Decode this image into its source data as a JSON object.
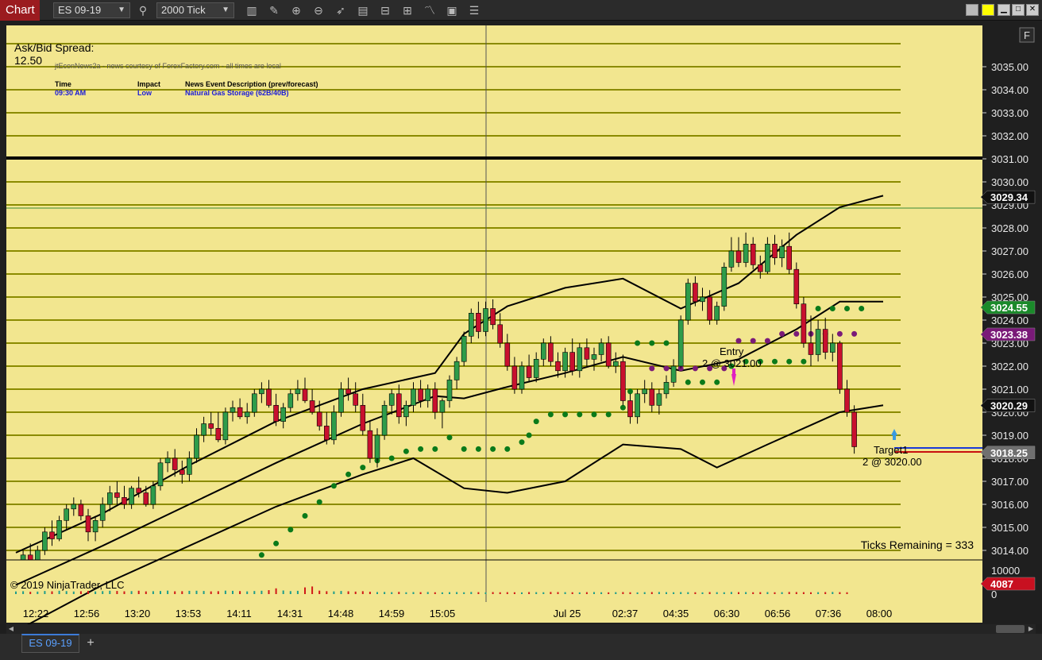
{
  "toolbar": {
    "chart_label": "Chart",
    "instrument": "ES 09-19",
    "interval": "2000 Tick",
    "icons": [
      "magnifier-icon",
      "bar-type-icon",
      "draw-icon",
      "zoom-in-icon",
      "zoom-out-icon",
      "pointer-icon",
      "data-box-icon",
      "templates-icon",
      "strategies-icon",
      "indicators-icon",
      "properties-icon",
      "chart-trader-icon"
    ],
    "window_buttons": [
      "color-gray-icon",
      "color-yellow-icon",
      "minimize-icon",
      "maximize-icon",
      "close-icon"
    ]
  },
  "colors": {
    "plot_bg": "#f2e68f",
    "chart_label_bg": "#9b1b1f",
    "grid_line": "#8b8b00",
    "up_candle": "#2e9c4a",
    "down_candle": "#c8102e",
    "bollinger": "#000000",
    "dots_green": "#0a7a1a",
    "dots_purple": "#7a1a78",
    "volume_up": "#1f9c8a",
    "volume_down": "#d01818"
  },
  "overlay": {
    "spread_label": "Ask/Bid Spread:",
    "spread_value": "12.50",
    "news_title": "jtEconNews2a - news courtesy of ForexFactory.com - all times are local",
    "news_headers": [
      "Time",
      "Impact",
      "News Event Description (prev/forecast)"
    ],
    "news_row": [
      "09:30 AM",
      "Low",
      "Natural Gas Storage (62B/40B)"
    ],
    "copyright": "© 2019 NinjaTrader, LLC",
    "ticks_remaining": "Ticks Remaining = 333",
    "f_button": "F"
  },
  "orders": {
    "entry_label": "Entry",
    "entry_detail": "2 @ 3021.00",
    "target_label": "Target1",
    "target_detail": "2 @ 3020.00"
  },
  "price_axis": {
    "ticks": [
      "3035.00",
      "3034.00",
      "3033.00",
      "3032.00",
      "3031.00",
      "3030.00",
      "3029.00",
      "3028.00",
      "3027.00",
      "3026.00",
      "3025.00",
      "3024.00",
      "3023.00",
      "3022.00",
      "3021.00",
      "3020.00",
      "3019.00",
      "3018.00",
      "3017.00",
      "3016.00",
      "3015.00",
      "3014.00"
    ],
    "price_markers": [
      {
        "value": "3029.34",
        "color": "#111111",
        "text_color": "#ffffff"
      },
      {
        "value": "3024.55",
        "color": "#1a8a2a",
        "text_color": "#ffffff"
      },
      {
        "value": "3023.38",
        "color": "#7a1a78",
        "text_color": "#ffffff"
      },
      {
        "value": "3020.29",
        "color": "#111111",
        "text_color": "#ffffff"
      },
      {
        "value": "3018.25",
        "color": "#707070",
        "text_color": "#ffffff"
      }
    ],
    "volume_ticks": [
      "10000",
      "0"
    ],
    "volume_marker": "4087"
  },
  "time_axis": {
    "labels": [
      "12:22",
      "12:56",
      "13:20",
      "13:53",
      "14:11",
      "14:31",
      "14:48",
      "14:59",
      "15:05",
      "Jul 25",
      "02:37",
      "04:35",
      "06:30",
      "06:56",
      "07:36",
      "08:00"
    ]
  },
  "chart_data": {
    "type": "candlestick",
    "instrument": "ES 09-19",
    "interval": "2000 Tick",
    "y_range": [
      3013.6,
      3035.8
    ],
    "candles": [
      [
        3012.8,
        3013.5,
        3012.5,
        3013.2
      ],
      [
        3013.2,
        3014.0,
        3013.0,
        3013.8
      ],
      [
        3013.8,
        3014.3,
        3013.2,
        3013.5
      ],
      [
        3013.5,
        3014.2,
        3013.3,
        3014.0
      ],
      [
        3014.0,
        3015.0,
        3013.8,
        3014.8
      ],
      [
        3014.8,
        3015.3,
        3014.2,
        3014.5
      ],
      [
        3014.5,
        3015.5,
        3014.4,
        3015.3
      ],
      [
        3015.3,
        3016.0,
        3014.9,
        3015.8
      ],
      [
        3015.8,
        3016.3,
        3015.5,
        3016.0
      ],
      [
        3016.0,
        3016.2,
        3015.3,
        3015.5
      ],
      [
        3015.5,
        3015.8,
        3014.4,
        3014.8
      ],
      [
        3014.8,
        3015.5,
        3014.4,
        3015.3
      ],
      [
        3015.3,
        3016.3,
        3015.0,
        3016.0
      ],
      [
        3016.0,
        3016.8,
        3015.7,
        3016.5
      ],
      [
        3016.5,
        3017.0,
        3016.0,
        3016.3
      ],
      [
        3016.3,
        3016.8,
        3015.8,
        3016.0
      ],
      [
        3016.0,
        3016.8,
        3015.8,
        3016.7
      ],
      [
        3016.7,
        3017.2,
        3016.3,
        3016.5
      ],
      [
        3016.5,
        3016.8,
        3015.9,
        3016.0
      ],
      [
        3016.0,
        3017.0,
        3015.8,
        3016.8
      ],
      [
        3016.8,
        3018.0,
        3016.6,
        3017.8
      ],
      [
        3017.8,
        3018.3,
        3017.4,
        3018.0
      ],
      [
        3018.0,
        3018.4,
        3017.2,
        3017.5
      ],
      [
        3017.5,
        3017.9,
        3016.9,
        3017.3
      ],
      [
        3017.3,
        3018.3,
        3017.0,
        3018.0
      ],
      [
        3018.0,
        3019.3,
        3017.8,
        3019.0
      ],
      [
        3019.0,
        3019.8,
        3018.7,
        3019.5
      ],
      [
        3019.5,
        3020.0,
        3019.0,
        3019.3
      ],
      [
        3019.3,
        3020.0,
        3018.7,
        3018.8
      ],
      [
        3018.8,
        3020.2,
        3018.6,
        3020.0
      ],
      [
        3020.0,
        3020.5,
        3019.6,
        3020.2
      ],
      [
        3020.2,
        3020.6,
        3019.7,
        3019.8
      ],
      [
        3019.8,
        3020.4,
        3019.5,
        3020.0
      ],
      [
        3020.0,
        3021.0,
        3019.8,
        3020.8
      ],
      [
        3020.8,
        3021.3,
        3020.4,
        3021.0
      ],
      [
        3021.0,
        3021.4,
        3020.2,
        3020.3
      ],
      [
        3020.3,
        3020.8,
        3019.4,
        3019.6
      ],
      [
        3019.6,
        3020.4,
        3019.3,
        3020.2
      ],
      [
        3020.2,
        3021.0,
        3020.0,
        3020.8
      ],
      [
        3020.8,
        3021.4,
        3020.5,
        3021.0
      ],
      [
        3021.0,
        3021.5,
        3020.4,
        3020.5
      ],
      [
        3020.5,
        3021.0,
        3019.9,
        3020.0
      ],
      [
        3020.0,
        3020.5,
        3019.2,
        3019.4
      ],
      [
        3019.4,
        3020.0,
        3018.6,
        3018.8
      ],
      [
        3018.8,
        3020.3,
        3018.6,
        3020.0
      ],
      [
        3020.0,
        3021.3,
        3019.8,
        3021.0
      ],
      [
        3021.0,
        3021.5,
        3020.5,
        3020.8
      ],
      [
        3020.8,
        3021.3,
        3020.0,
        3020.3
      ],
      [
        3020.3,
        3020.8,
        3019.0,
        3019.2
      ],
      [
        3019.2,
        3019.6,
        3017.8,
        3018.0
      ],
      [
        3018.0,
        3019.3,
        3017.6,
        3019.0
      ],
      [
        3019.0,
        3020.5,
        3018.8,
        3020.3
      ],
      [
        3020.3,
        3021.0,
        3019.9,
        3020.8
      ],
      [
        3020.8,
        3021.2,
        3019.5,
        3019.8
      ],
      [
        3019.8,
        3020.5,
        3019.4,
        3020.3
      ],
      [
        3020.3,
        3021.3,
        3020.0,
        3021.0
      ],
      [
        3021.0,
        3021.4,
        3020.2,
        3020.5
      ],
      [
        3020.5,
        3021.2,
        3020.2,
        3021.0
      ],
      [
        3021.0,
        3021.3,
        3019.7,
        3020.0
      ],
      [
        3020.0,
        3020.6,
        3019.3,
        3020.5
      ],
      [
        3020.5,
        3021.6,
        3020.2,
        3021.4
      ],
      [
        3021.4,
        3022.4,
        3021.0,
        3022.2
      ],
      [
        3022.2,
        3023.5,
        3022.0,
        3023.3
      ],
      [
        3023.3,
        3024.5,
        3023.0,
        3024.3
      ],
      [
        3024.3,
        3024.8,
        3023.2,
        3023.5
      ],
      [
        3023.5,
        3024.8,
        3023.3,
        3024.5
      ],
      [
        3024.5,
        3024.9,
        3023.6,
        3023.8
      ],
      [
        3023.8,
        3024.3,
        3022.8,
        3023.0
      ],
      [
        3023.0,
        3023.4,
        3021.8,
        3022.0
      ],
      [
        3022.0,
        3022.4,
        3020.8,
        3021.0
      ],
      [
        3021.0,
        3022.2,
        3020.8,
        3022.0
      ],
      [
        3022.0,
        3022.5,
        3021.3,
        3021.5
      ],
      [
        3021.5,
        3022.6,
        3021.3,
        3022.3
      ],
      [
        3022.3,
        3023.2,
        3022.0,
        3023.0
      ],
      [
        3023.0,
        3023.3,
        3022.0,
        3022.2
      ],
      [
        3022.2,
        3022.6,
        3021.5,
        3021.8
      ],
      [
        3021.8,
        3022.8,
        3021.5,
        3022.6
      ],
      [
        3022.6,
        3023.2,
        3021.6,
        3021.8
      ],
      [
        3021.8,
        3023.0,
        3021.5,
        3022.8
      ],
      [
        3022.8,
        3023.2,
        3022.0,
        3022.3
      ],
      [
        3022.3,
        3022.8,
        3021.8,
        3022.5
      ],
      [
        3022.5,
        3023.2,
        3022.2,
        3023.0
      ],
      [
        3023.0,
        3023.3,
        3021.9,
        3022.0
      ],
      [
        3022.0,
        3022.6,
        3021.7,
        3022.2
      ],
      [
        3022.2,
        3022.5,
        3020.3,
        3020.5
      ],
      [
        3020.5,
        3020.8,
        3019.5,
        3019.8
      ],
      [
        3019.8,
        3021.0,
        3019.5,
        3020.8
      ],
      [
        3020.8,
        3021.4,
        3020.4,
        3021.0
      ],
      [
        3021.0,
        3021.3,
        3020.0,
        3020.3
      ],
      [
        3020.3,
        3021.0,
        3019.9,
        3020.8
      ],
      [
        3020.8,
        3021.6,
        3020.6,
        3021.3
      ],
      [
        3021.3,
        3022.3,
        3021.1,
        3022.0
      ],
      [
        3022.0,
        3024.2,
        3021.9,
        3024.0
      ],
      [
        3024.0,
        3025.8,
        3023.8,
        3025.6
      ],
      [
        3025.6,
        3025.9,
        3024.6,
        3024.8
      ],
      [
        3024.8,
        3025.4,
        3024.4,
        3025.0
      ],
      [
        3025.0,
        3025.3,
        3023.8,
        3024.0
      ],
      [
        3024.0,
        3024.8,
        3023.8,
        3024.6
      ],
      [
        3024.6,
        3026.5,
        3024.4,
        3026.3
      ],
      [
        3026.3,
        3027.6,
        3026.1,
        3027.0
      ],
      [
        3027.0,
        3027.6,
        3026.3,
        3026.5
      ],
      [
        3026.5,
        3027.8,
        3026.3,
        3027.3
      ],
      [
        3027.3,
        3027.6,
        3026.2,
        3026.4
      ],
      [
        3026.4,
        3026.8,
        3025.8,
        3026.1
      ],
      [
        3026.1,
        3027.6,
        3026.0,
        3027.3
      ],
      [
        3027.3,
        3027.7,
        3026.4,
        3026.7
      ],
      [
        3026.7,
        3027.5,
        3026.3,
        3027.2
      ],
      [
        3027.2,
        3027.8,
        3026.0,
        3026.2
      ],
      [
        3026.2,
        3026.5,
        3024.5,
        3024.7
      ],
      [
        3024.7,
        3025.0,
        3022.8,
        3023.0
      ],
      [
        3023.0,
        3024.2,
        3022.0,
        3022.5
      ],
      [
        3022.5,
        3024.0,
        3022.2,
        3023.6
      ],
      [
        3023.6,
        3024.1,
        3022.3,
        3022.6
      ],
      [
        3022.6,
        3023.4,
        3022.2,
        3023.0
      ],
      [
        3023.0,
        3023.1,
        3020.8,
        3021.0
      ],
      [
        3021.0,
        3021.4,
        3019.8,
        3020.0
      ],
      [
        3020.0,
        3020.3,
        3018.2,
        3018.5
      ]
    ],
    "volume": [
      550,
      600,
      480,
      520,
      650,
      580,
      700,
      620,
      540,
      600,
      680,
      560,
      620,
      700,
      650,
      580,
      620,
      700,
      560,
      600,
      640,
      720,
      580,
      600,
      680,
      700,
      650,
      560,
      600,
      720,
      680,
      620,
      560,
      640,
      700,
      820,
      1200,
      750,
      620,
      680,
      1400,
      1600,
      720,
      600,
      560,
      650,
      580,
      520,
      600,
      480,
      420,
      440,
      400,
      460,
      380,
      420,
      400,
      440,
      380,
      360,
      400,
      420,
      380,
      440,
      400,
      360,
      420,
      380,
      400,
      380,
      360,
      420,
      400,
      380,
      440,
      420,
      400,
      380,
      360,
      400,
      420,
      380,
      360,
      400,
      420,
      380,
      360,
      400,
      420,
      440,
      400,
      380,
      420,
      400,
      380,
      360,
      420,
      400,
      380,
      440,
      400,
      420,
      380,
      400,
      420,
      380,
      400,
      440,
      420,
      400,
      380,
      400,
      420,
      440,
      400,
      380
    ],
    "bollinger": {
      "upper": [
        [
          0,
          3013.9
        ],
        [
          12,
          3015.6
        ],
        [
          24,
          3017.7
        ],
        [
          36,
          3019.6
        ],
        [
          48,
          3021.0
        ],
        [
          58,
          3021.7
        ],
        [
          62,
          3023.4
        ],
        [
          68,
          3024.6
        ],
        [
          76,
          3025.4
        ],
        [
          84,
          3025.8
        ],
        [
          92,
          3024.5
        ],
        [
          100,
          3025.6
        ],
        [
          108,
          3027.7
        ],
        [
          114,
          3028.9
        ],
        [
          120,
          3029.4
        ]
      ],
      "middle": [
        [
          0,
          3012.5
        ],
        [
          12,
          3014.2
        ],
        [
          24,
          3016.0
        ],
        [
          36,
          3017.8
        ],
        [
          48,
          3019.5
        ],
        [
          58,
          3020.7
        ],
        [
          62,
          3020.6
        ],
        [
          68,
          3021.1
        ],
        [
          76,
          3021.7
        ],
        [
          84,
          3022.4
        ],
        [
          92,
          3021.8
        ],
        [
          100,
          3022.3
        ],
        [
          108,
          3023.6
        ],
        [
          114,
          3024.8
        ],
        [
          120,
          3024.8
        ]
      ],
      "lower": [
        [
          0,
          3010.5
        ],
        [
          12,
          3012.5
        ],
        [
          24,
          3014.2
        ],
        [
          36,
          3015.9
        ],
        [
          48,
          3017.3
        ],
        [
          55,
          3018.0
        ],
        [
          62,
          3016.7
        ],
        [
          68,
          3016.5
        ],
        [
          76,
          3017.0
        ],
        [
          84,
          3018.6
        ],
        [
          92,
          3018.4
        ],
        [
          97,
          3017.6
        ],
        [
          104,
          3018.6
        ],
        [
          114,
          3020.0
        ],
        [
          120,
          3020.3
        ]
      ]
    },
    "dots_green": [
      [
        34,
        3013.8
      ],
      [
        36,
        3014.3
      ],
      [
        38,
        3014.9
      ],
      [
        40,
        3015.5
      ],
      [
        42,
        3016.1
      ],
      [
        44,
        3016.8
      ],
      [
        46,
        3017.3
      ],
      [
        48,
        3017.6
      ],
      [
        50,
        3017.9
      ],
      [
        52,
        3018.0
      ],
      [
        54,
        3018.3
      ],
      [
        56,
        3018.4
      ],
      [
        58,
        3018.4
      ],
      [
        60,
        3018.9
      ],
      [
        62,
        3018.4
      ],
      [
        64,
        3018.4
      ],
      [
        66,
        3018.4
      ],
      [
        68,
        3018.4
      ],
      [
        70,
        3018.7
      ],
      [
        71,
        3019.0
      ],
      [
        72,
        3019.6
      ],
      [
        74,
        3019.9
      ],
      [
        76,
        3019.9
      ],
      [
        78,
        3019.9
      ],
      [
        80,
        3019.9
      ],
      [
        82,
        3019.9
      ],
      [
        84,
        3020.2
      ],
      [
        85,
        3020.9
      ],
      [
        86,
        3023.0
      ],
      [
        88,
        3023.0
      ],
      [
        90,
        3023.0
      ],
      [
        92,
        3023.0
      ],
      [
        93,
        3021.3
      ],
      [
        95,
        3021.3
      ],
      [
        97,
        3021.3
      ],
      [
        99,
        3022.0
      ],
      [
        101,
        3022.2
      ],
      [
        103,
        3022.2
      ],
      [
        105,
        3022.2
      ],
      [
        107,
        3022.2
      ],
      [
        109,
        3022.2
      ],
      [
        111,
        3024.5
      ],
      [
        113,
        3024.5
      ],
      [
        115,
        3024.5
      ],
      [
        117,
        3024.5
      ]
    ],
    "dots_purple": [
      [
        88,
        3021.9
      ],
      [
        90,
        3021.9
      ],
      [
        92,
        3021.9
      ],
      [
        94,
        3021.9
      ],
      [
        96,
        3021.9
      ],
      [
        98,
        3021.9
      ],
      [
        100,
        3023.1
      ],
      [
        102,
        3023.1
      ],
      [
        104,
        3023.1
      ],
      [
        106,
        3023.4
      ],
      [
        108,
        3023.4
      ],
      [
        110,
        3023.4
      ],
      [
        112,
        3023.4
      ],
      [
        114,
        3023.4
      ],
      [
        116,
        3023.4
      ]
    ]
  }
}
